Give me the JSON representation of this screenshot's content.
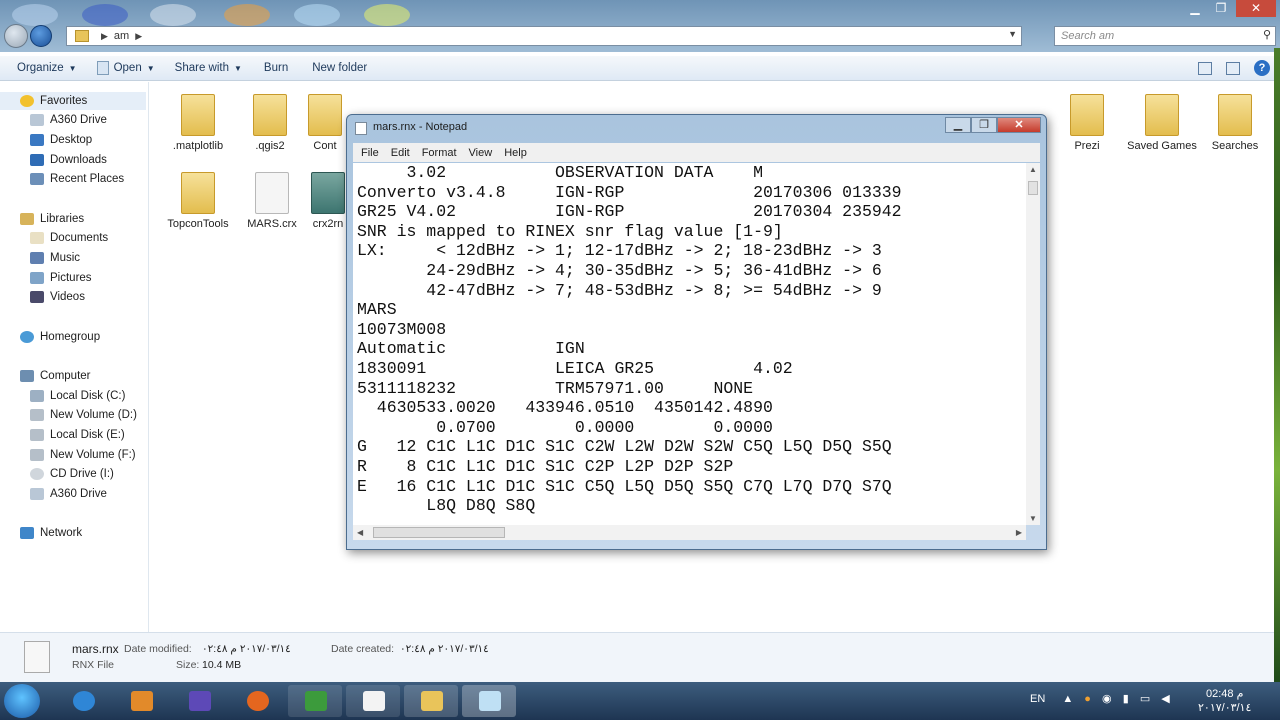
{
  "explorer": {
    "breadcrumb": [
      "am"
    ],
    "search_placeholder": "Search am",
    "window_controls": {
      "minimize": "▁",
      "maximize": "❐",
      "close": "✕"
    }
  },
  "toolbar": {
    "organize": "Organize",
    "open": "Open",
    "share_with": "Share with",
    "burn": "Burn",
    "new_folder": "New folder",
    "help": "?"
  },
  "sidebar": {
    "favorites": {
      "label": "Favorites",
      "items": [
        "A360 Drive",
        "Desktop",
        "Downloads",
        "Recent Places"
      ]
    },
    "libraries": {
      "label": "Libraries",
      "items": [
        "Documents",
        "Music",
        "Pictures",
        "Videos"
      ]
    },
    "homegroup": "Homegroup",
    "computer": {
      "label": "Computer",
      "items": [
        "Local Disk (C:)",
        "New Volume (D:)",
        "Local Disk (E:)",
        "New Volume (F:)",
        "CD Drive (I:)",
        "A360 Drive"
      ]
    },
    "network": "Network"
  },
  "files": [
    {
      "name": ".matplotlib",
      "kind": "folder"
    },
    {
      "name": ".qgis2",
      "kind": "folder"
    },
    {
      "name": "Cont",
      "kind": "folder"
    },
    {
      "name": "Prezi",
      "kind": "folder"
    },
    {
      "name": "Saved Games",
      "kind": "folder"
    },
    {
      "name": "Searches",
      "kind": "folder"
    },
    {
      "name": "TopconTools",
      "kind": "folder"
    },
    {
      "name": "MARS.crx",
      "kind": "file"
    },
    {
      "name": "crx2rn",
      "kind": "exe"
    }
  ],
  "details": {
    "file_name": "mars.rnx",
    "file_type": "RNX File",
    "date_modified_label": "Date modified:",
    "date_modified": "٢٠١٧/٠٣/١٤ م ٠٢:٤٨",
    "size_label": "Size:",
    "size": "10.4 MB",
    "date_created_label": "Date created:",
    "date_created": "٢٠١٧/٠٣/١٤ م ٠٢:٤٨"
  },
  "notepad": {
    "title": "mars.rnx - Notepad",
    "menu": [
      "File",
      "Edit",
      "Format",
      "View",
      "Help"
    ],
    "window_controls": {
      "minimize": "▁",
      "maximize": "❐",
      "close": "✕"
    },
    "lines": [
      "     3.02           OBSERVATION DATA    M",
      "Converto v3.4.8     IGN-RGP             20170306 013339",
      "GR25 V4.02          IGN-RGP             20170304 235942",
      "SNR is mapped to RINEX snr flag value [1-9]",
      "LX:     < 12dBHz -> 1; 12-17dBHz -> 2; 18-23dBHz -> 3",
      "       24-29dBHz -> 4; 30-35dBHz -> 5; 36-41dBHz -> 6",
      "       42-47dBHz -> 7; 48-53dBHz -> 8; >= 54dBHz -> 9",
      "MARS",
      "10073M008",
      "Automatic           IGN",
      "1830091             LEICA GR25          4.02",
      "5311118232          TRM57971.00     NONE",
      "  4630533.0020   433946.0510  4350142.4890",
      "        0.0700        0.0000        0.0000",
      "G   12 C1C L1C D1C S1C C2W L2W D2W S2W C5Q L5Q D5Q S5Q",
      "R    8 C1C L1C D1C S1C C2P L2P D2P S2P",
      "E   16 C1C L1C D1C S1C C5Q L5Q D5Q S5Q C7Q L7Q D7Q S7Q",
      "       L8Q D8Q S8Q"
    ]
  },
  "taskbar": {
    "language": "EN",
    "time": "02:48 م",
    "date": "٢٠١٧/٠٣/١٤"
  },
  "colors": {
    "explorer_title": "#8aaccb",
    "notepad_close": "#c53b2c",
    "taskbar": "#2a4666"
  }
}
